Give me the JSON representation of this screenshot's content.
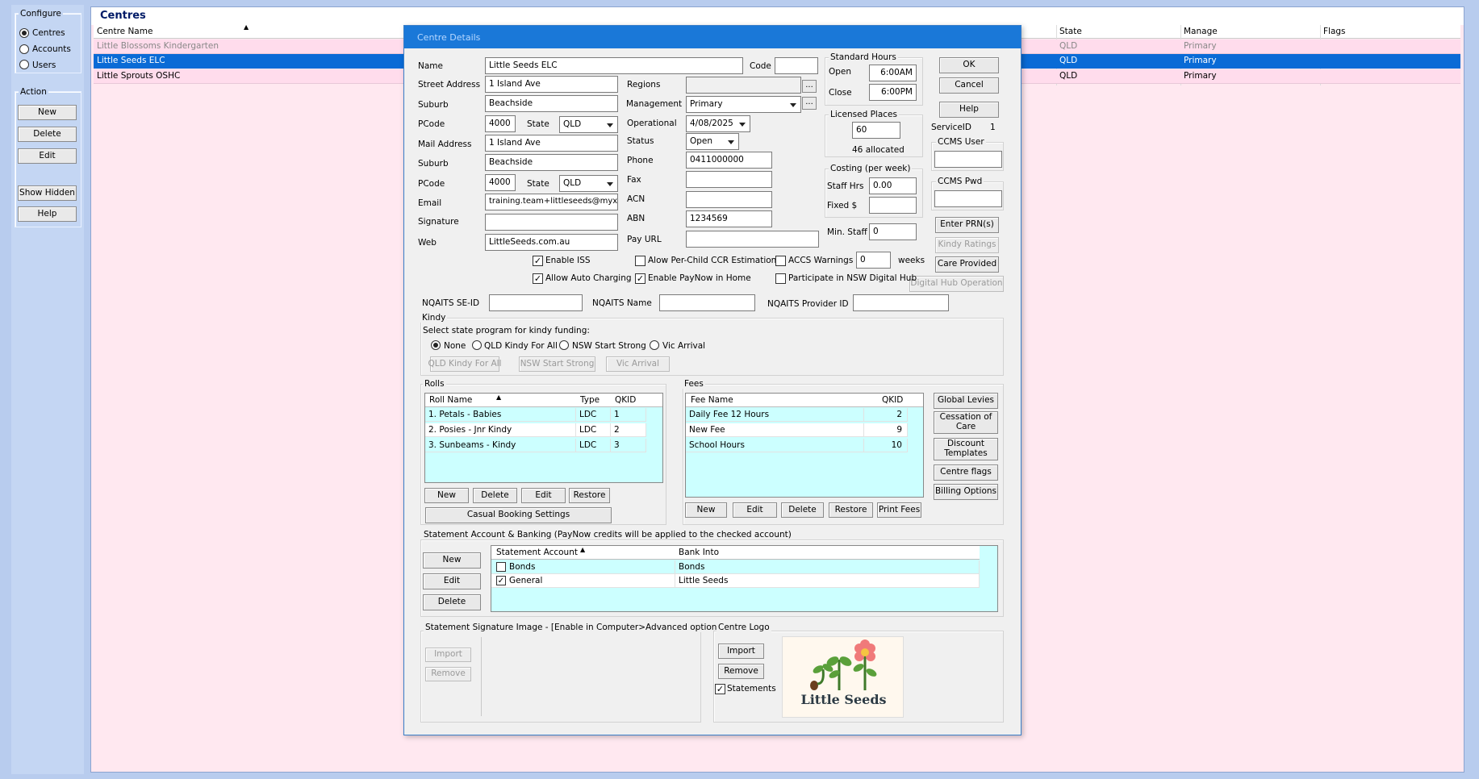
{
  "left": {
    "configure_title": "Configure",
    "configure_items": [
      "Centres",
      "Accounts",
      "Users"
    ],
    "action_title": "Action",
    "action_buttons": [
      "New",
      "Delete",
      "Edit",
      "Show Hidden",
      "Help"
    ]
  },
  "main": {
    "title": "Centres",
    "columns": [
      "Centre Name",
      "State",
      "Manage",
      "Flags"
    ],
    "rows": [
      {
        "name": "Little Blossoms Kindergarten",
        "state": "QLD",
        "manage": "Primary"
      },
      {
        "name": "Little Seeds ELC",
        "state": "QLD",
        "manage": "Primary"
      },
      {
        "name": "Little Sprouts OSHC",
        "state": "QLD",
        "manage": "Primary"
      }
    ]
  },
  "dialog": {
    "title": "Centre Details",
    "labels": {
      "name": "Name",
      "code": "Code",
      "street": "Street Address",
      "suburb": "Suburb",
      "pcode": "PCode",
      "state": "State",
      "mail": "Mail Address",
      "email": "Email",
      "signature": "Signature",
      "web": "Web",
      "regions": "Regions",
      "management": "Management",
      "operational": "Operational",
      "status": "Status",
      "phone": "Phone",
      "fax": "Fax",
      "acn": "ACN",
      "abn": "ABN",
      "payurl": "Pay URL",
      "std_hours": "Standard Hours",
      "open": "Open",
      "close": "Close",
      "licensed": "Licensed Places",
      "allocated": "46 allocated",
      "costing": "Costing (per week)",
      "staff_hrs": "Staff Hrs",
      "fixed": "Fixed $",
      "min_staff": "Min. Staff",
      "service_id": "ServiceID",
      "ccms_user": "CCMS User",
      "ccms_pwd": "CCMS Pwd",
      "weeks": "weeks",
      "nqaits_seid": "NQAITS SE-ID",
      "nqaits_name": "NQAITS Name",
      "nqaits_provider": "NQAITS Provider ID",
      "kindy": "Kindy",
      "kindy_select": "Select state program for kindy funding:"
    },
    "values": {
      "name": "Little Seeds ELC",
      "code": "",
      "street": "1 Island Ave",
      "suburb": "Beachside",
      "pcode": "4000",
      "state": "QLD",
      "mail": "1 Island Ave",
      "mail_suburb": "Beachside",
      "mail_pcode": "4000",
      "mail_state": "QLD",
      "email": "training.team+littleseeds@myxp",
      "signature": "",
      "web": "LittleSeeds.com.au",
      "management": "Primary",
      "operational": "4/08/2025",
      "status": "Open",
      "phone": "0411000000",
      "fax": "",
      "acn": "",
      "abn": "1234569",
      "payurl": "",
      "open": "6:00AM",
      "close": "6:00PM",
      "licensed": "60",
      "staff_hrs": "0.00",
      "fixed": "",
      "min_staff": "0",
      "service_id": "1",
      "accs_weeks": "0"
    },
    "checks": {
      "enable_iss": "Enable ISS",
      "allow_auto": "Allow Auto Charging",
      "per_child": "Alow Per-Child CCR Estimation",
      "paynow": "Enable PayNow in Home",
      "accs": "ACCS Warnings",
      "nsw_hub": "Participate in NSW Digital Hub"
    },
    "buttons": {
      "ok": "OK",
      "cancel": "Cancel",
      "help": "Help",
      "enter_prn": "Enter PRN(s)",
      "kindy_ratings": "Kindy Ratings",
      "care_provided": "Care Provided",
      "digital_hub": "Digital Hub Operation",
      "qld_kindy": "QLD Kindy For All",
      "nsw_strong": "NSW Start Strong",
      "vic_arrival": "Vic Arrival",
      "global_levies": "Global Levies",
      "cessation": "Cessation of Care",
      "discount": "Discount Templates",
      "centre_flags": "Centre flags",
      "billing": "Billing Options",
      "casual": "Casual Booking Settings",
      "new": "New",
      "delete": "Delete",
      "edit": "Edit",
      "restore": "Restore",
      "print_fees": "Print Fees",
      "import": "Import",
      "remove": "Remove",
      "dots": "..."
    },
    "kindy_radios": [
      "None",
      "QLD Kindy For All",
      "NSW Start Strong",
      "Vic Arrival"
    ],
    "rolls": {
      "title": "Rolls",
      "columns": [
        "Roll Name",
        "Type",
        "QKID"
      ],
      "rows": [
        {
          "name": "1. Petals - Babies",
          "type": "LDC",
          "qkid": "1"
        },
        {
          "name": "2. Posies - Jnr Kindy",
          "type": "LDC",
          "qkid": "2"
        },
        {
          "name": "3. Sunbeams - Kindy",
          "type": "LDC",
          "qkid": "3"
        }
      ]
    },
    "fees": {
      "title": "Fees",
      "columns": [
        "Fee Name",
        "QKID"
      ],
      "rows": [
        {
          "name": "Daily Fee 12 Hours",
          "qkid": "2"
        },
        {
          "name": "New Fee",
          "qkid": "9"
        },
        {
          "name": "School Hours",
          "qkid": "10"
        }
      ]
    },
    "statement": {
      "title": "Statement Account & Banking (PayNow credits will be applied to the checked account)",
      "columns": [
        "Statement Account",
        "Bank Into"
      ],
      "rows": [
        {
          "account": "Bonds",
          "bank": "Bonds",
          "checked": false
        },
        {
          "account": "General",
          "bank": "Little Seeds",
          "checked": true
        }
      ]
    },
    "sig_image_title": "Statement Signature Image - [Enable in Computer>Advanced options]",
    "logo_title": "Centre Logo",
    "logo_text": "Little Seeds",
    "statements_label": "Statements"
  }
}
